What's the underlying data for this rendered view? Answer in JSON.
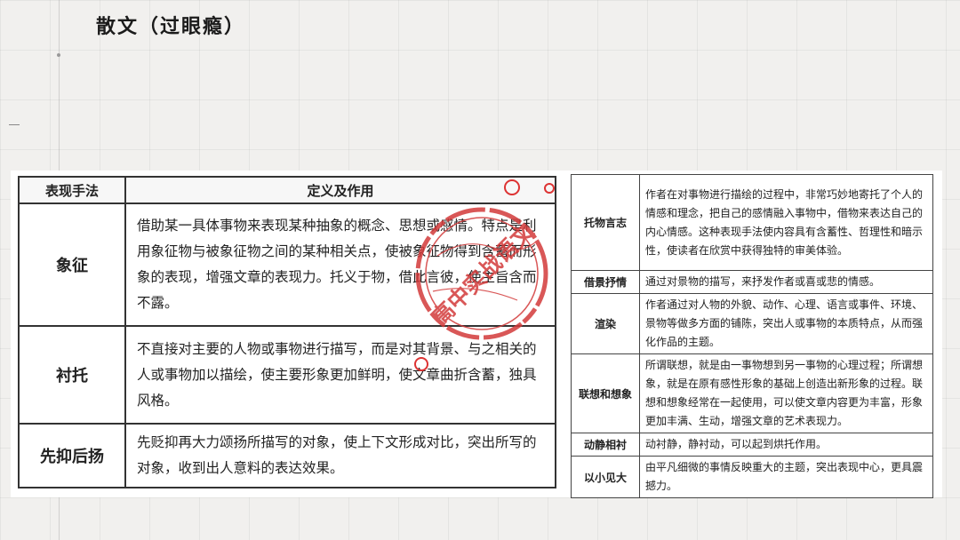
{
  "page": {
    "title": "散文（过眼瘾）"
  },
  "left_table": {
    "header": {
      "term": "表现手法",
      "definition": "定义及作用"
    },
    "rows": [
      {
        "term": "象征",
        "definition": "借助某一具体事物来表现某种抽象的概念、思想或感情。特点是利用象征物与被象征物之间的某种相关点，使被象征物得到含蓄而形象的表现，增强文章的表现力。托义于物，借此言彼，使主旨含而不露。"
      },
      {
        "term": "衬托",
        "definition": "不直接对主要的人物或事物进行描写，而是对其背景、与之相关的人或事物加以描绘，使主要形象更加鲜明，使文章曲折含蓄，独具风格。"
      },
      {
        "term": "先抑后扬",
        "definition": "先贬抑再大力颂扬所描写的对象，使上下文形成对比，突出所写的对象，收到出人意料的表达效果。"
      }
    ]
  },
  "right_table": {
    "rows": [
      {
        "term": "托物言志",
        "definition": "作者在对事物进行描绘的过程中，非常巧妙地寄托了个人的情感和理念，把自己的感情融入事物中，借物来表达自己的内心情感。这种表现手法使内容具有含蓄性、哲理性和暗示性，使读者在欣赏中获得独特的审美体验。"
      },
      {
        "term": "借景抒情",
        "definition": "通过对景物的描写，来抒发作者或喜或悲的情感。"
      },
      {
        "term": "渲染",
        "definition": "作者通过对人物的外貌、动作、心理、语言或事件、环境、景物等做多方面的铺陈，突出人或事物的本质特点，从而强化作品的主题。"
      },
      {
        "term": "联想和想象",
        "definition": "所谓联想，就是由一事物想到另一事物的心理过程；所谓想象，就是在原有感性形象的基础上创造出新形象的过程。联想和想象经常在一起使用，可以使文章内容更为丰富，形象更加丰满、生动，增强文章的艺术表现力。"
      },
      {
        "term": "动静相衬",
        "definition": "动衬静，静衬动，可以起到烘托作用。"
      },
      {
        "term": "以小见大",
        "definition": "由平凡细微的事情反映重大的主题，突出表现中心，更具震撼力。"
      }
    ]
  },
  "stamp": {
    "text": "高中实战语文",
    "color": "#d33a3a"
  }
}
